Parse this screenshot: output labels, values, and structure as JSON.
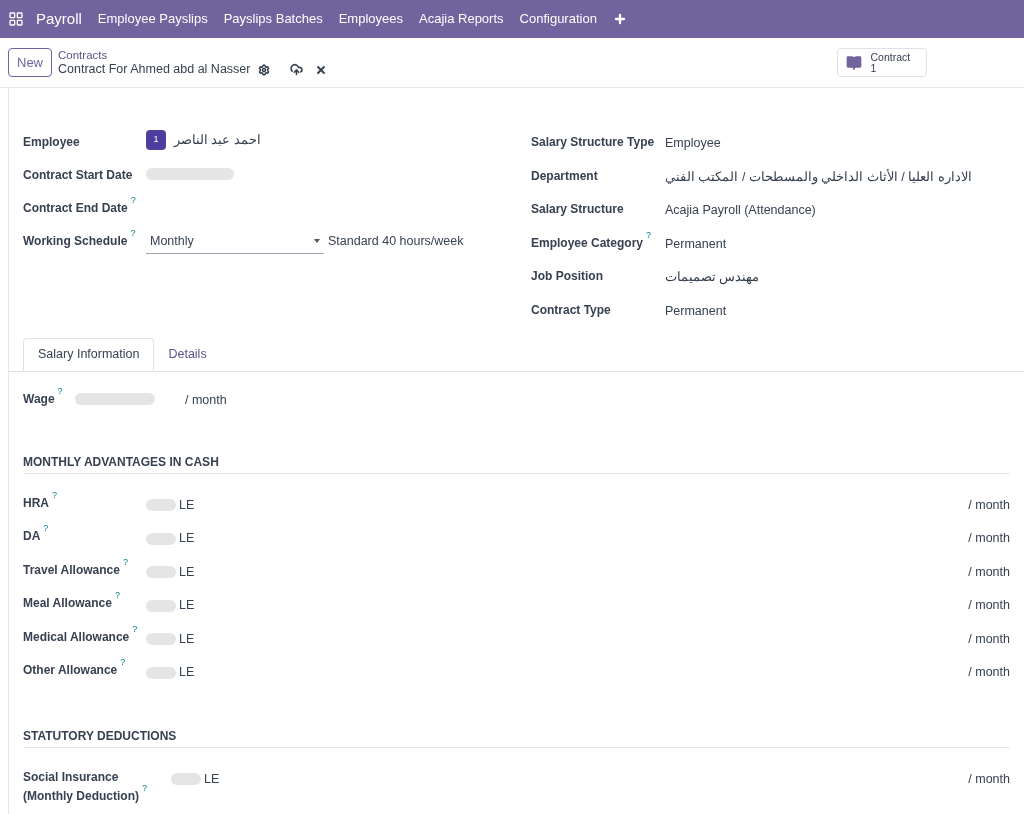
{
  "navbar": {
    "app": "Payroll",
    "menu": [
      "Employee Payslips",
      "Payslips Batches",
      "Employees",
      "Acajia Reports",
      "Configuration"
    ]
  },
  "control_panel": {
    "new_button": "New",
    "breadcrumb": "Contracts",
    "record_title": "Contract For Ahmed abd al Nasser",
    "smart_button": {
      "label": "Contract",
      "count": "1"
    }
  },
  "left_fields": [
    {
      "kind": "employee",
      "label": "Employee",
      "avatar": "1",
      "value": "احمد عبد الناصر"
    },
    {
      "kind": "redacted",
      "label": "Contract Start Date"
    },
    {
      "kind": "empty",
      "label": "Contract End Date",
      "help": "?"
    },
    {
      "kind": "select",
      "label": "Working Schedule",
      "help": "?",
      "value": "Monthly",
      "suffix": "Standard 40 hours/week"
    }
  ],
  "right_fields": [
    {
      "label": "Salary Structure Type",
      "value": "Employee"
    },
    {
      "label": "Department",
      "value": "الاداره العليا / الأثاث الداخلي والمسطحات / المكتب الفني"
    },
    {
      "label": "Salary Structure",
      "value": "Acajia Payroll (Attendance)"
    },
    {
      "label": "Employee Category",
      "help": "?",
      "value": "Permanent"
    },
    {
      "label": "Job Position",
      "value": "مهندس تصميمات"
    },
    {
      "label": "Contract Type",
      "value": "Permanent"
    }
  ],
  "tabs": [
    {
      "label": "Salary Information",
      "selected": true
    },
    {
      "label": "Details",
      "selected": false
    }
  ],
  "wage": {
    "label": "Wage",
    "help": "?",
    "unit": "/ month"
  },
  "sections": [
    {
      "title": "MONTHLY ADVANTAGES IN CASH",
      "rows": [
        {
          "label": "HRA",
          "help": "?",
          "currency": "LE",
          "unit": "/ month"
        },
        {
          "label": "DA",
          "help": "?",
          "currency": "LE",
          "unit": "/ month"
        },
        {
          "label": "Travel Allowance",
          "help": "?",
          "currency": "LE",
          "unit": "/ month"
        },
        {
          "label": "Meal Allowance",
          "help": "?",
          "currency": "LE",
          "unit": "/ month"
        },
        {
          "label": "Medical Allowance",
          "help": "?",
          "currency": "LE",
          "unit": "/ month"
        },
        {
          "label": "Other Allowance",
          "help": "?",
          "currency": "LE",
          "unit": "/ month"
        }
      ]
    },
    {
      "title": "STATUTORY DEDUCTIONS",
      "rows": [
        {
          "label": "Social Insurance (Monthly Deduction)",
          "help": "?",
          "currency": "LE",
          "unit": "/ month"
        }
      ]
    }
  ]
}
